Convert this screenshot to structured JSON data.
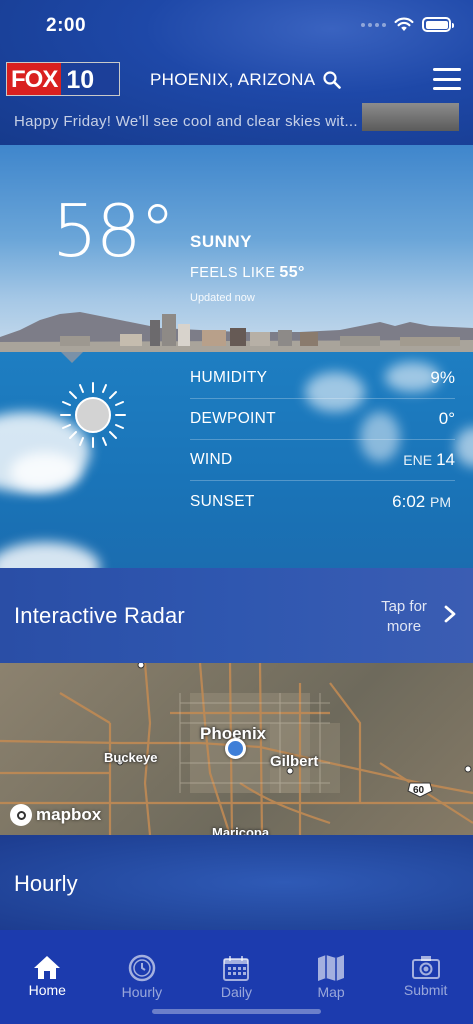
{
  "status_bar": {
    "time": "2:00"
  },
  "header": {
    "logo_fox": "FOX",
    "logo_ten": "10",
    "location": "PHOENIX, ARIZONA",
    "ticker_text": "Happy Friday! We'll see cool and clear skies wit..."
  },
  "current": {
    "temperature": "58°",
    "condition": "SUNNY",
    "feels_like_label": "FEELS LIKE",
    "feels_like_value": "55°",
    "updated": "Updated now"
  },
  "details": {
    "humidity_label": "HUMIDITY",
    "humidity_value": "9%",
    "dewpoint_label": "DEWPOINT",
    "dewpoint_value": "0°",
    "wind_label": "WIND",
    "wind_dir": "ENE",
    "wind_value": "14",
    "sunset_label": "SUNSET",
    "sunset_time": "6:02",
    "sunset_ampm": "PM"
  },
  "radar": {
    "title": "Interactive Radar",
    "tap_for": "Tap for",
    "more": "more"
  },
  "map": {
    "labels": {
      "phoenix": "Phoenix",
      "buckeye": "Buckeye",
      "gilbert": "Gilbert",
      "maricopa": "Maricopa",
      "highway": "60"
    },
    "attribution": "mapbox"
  },
  "hourly": {
    "title": "Hourly"
  },
  "tabs": [
    {
      "label": "Home",
      "icon": "home-icon",
      "active": true
    },
    {
      "label": "Hourly",
      "icon": "clock-icon",
      "active": false
    },
    {
      "label": "Daily",
      "icon": "calendar-icon",
      "active": false
    },
    {
      "label": "Map",
      "icon": "map-icon",
      "active": false
    },
    {
      "label": "Submit",
      "icon": "camera-icon",
      "active": false
    }
  ],
  "colors": {
    "brand_red": "#d9201f",
    "brand_blue": "#1c3f99",
    "tabbar": "#1c3bae",
    "location_dot": "#3f7fd8"
  }
}
